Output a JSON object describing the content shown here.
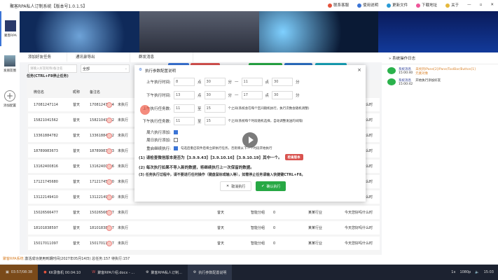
{
  "title": "聚客RPA私人订制系统【版本号1.0.1.5】",
  "titlebar_links": [
    "联系客服",
    "使用说明",
    "更新文件",
    "下载地址",
    "关于"
  ],
  "sidebar": {
    "items": [
      "聚客RPA",
      "发朋友圈",
      "添加配置"
    ]
  },
  "tabs": [
    "添加好友任务",
    "通讯录导出",
    "群发消息"
  ],
  "search": {
    "placeholder": "请输入好友昵称/备注名"
  },
  "select": {
    "value": "全部"
  },
  "task_label": "任务(CTRL+F8停止任务)",
  "table": {
    "headers": [
      "微信名",
      "昵称",
      "备注名"
    ],
    "rows": [
      [
        "17081247114",
        "昔天",
        "17081247114",
        "未执行",
        "昔天",
        "智能分组",
        "0",
        "某某行业",
        "今天您好吗什么时"
      ],
      [
        "15821041562",
        "昔天",
        "15821041562",
        "未执行",
        "昔天",
        "智能分组",
        "0",
        "某某行业",
        "今天您好吗什么时"
      ],
      [
        "13361884782",
        "昔天",
        "13361884782",
        "未执行",
        "昔天",
        "智能分组",
        "0",
        "某某行业",
        "今天您好吗什么时"
      ],
      [
        "18789983673",
        "昔天",
        "18789983673",
        "未执行",
        "昔天",
        "智能分组",
        "0",
        "某某行业",
        "今天您好吗什么时"
      ],
      [
        "13162400816",
        "昔天",
        "13162400816",
        "未执行",
        "昔天",
        "智能分组",
        "0",
        "某某行业",
        "今天您好吗什么时"
      ],
      [
        "17121745680",
        "昔天",
        "17121745680",
        "未执行",
        "昔天",
        "智能分组",
        "0",
        "某某行业",
        "今天您好吗什么时"
      ],
      [
        "13122149410",
        "昔天",
        "13122149410",
        "未执行",
        "昔天",
        "智能分组",
        "0",
        "某某行业",
        "今天您好吗什么时"
      ],
      [
        "15026566477",
        "昔天",
        "15026566477",
        "未执行",
        "昔天",
        "智能分组",
        "0",
        "某某行业",
        "今天您好吗什么时"
      ],
      [
        "18101838597",
        "昔天",
        "18101838597",
        "未执行",
        "昔天",
        "智能分组",
        "0",
        "某某行业",
        "今天您好吗什么时"
      ],
      [
        "15017011097",
        "昔天",
        "15017011097",
        "未执行",
        "昔天",
        "智能分组",
        "0",
        "某某行业",
        "今天您好吗什么时"
      ]
    ]
  },
  "right_panel": {
    "title": "系统操作日志",
    "logs": [
      {
        "name": "系统消息",
        "time": "15:00:40",
        "text": "未找到/Pane[2]/Pane/ToolBar/Button[1]元素对象"
      },
      {
        "name": "系统消息",
        "time": "15:00:42",
        "text": "开始执行添加好友"
      }
    ]
  },
  "modal": {
    "title": "执行参数配置说明",
    "close": "×",
    "am_label": "上午执行时间:",
    "am": [
      "8",
      "30",
      "11",
      "30"
    ],
    "pm_label": "下午执行时间:",
    "pm": [
      "13",
      "30",
      "17",
      "30"
    ],
    "u_hour": "点",
    "u_min": "分",
    "dash": "—",
    "am_count_label": "上午执行任务数:",
    "am_count": [
      "11",
      "15"
    ],
    "pm_count_label": "下午执行任务数:",
    "pm_count": [
      "11",
      "15"
    ],
    "to": "至",
    "am_hint": "个之间(系统会在每个区间随机执行，执行次数会随机调整)",
    "pm_hint": "个之间(系统每个时段随机选择，自动调整发送的间隔)",
    "weekend_label": "周六执行添加:",
    "sunday_label": "周日执行添加:",
    "repeat_label": "重启继续执行:",
    "repeat_hint": "勾选后重启软件后将立即执行任务，否则将从下一个时段开始执行",
    "note1": "(1) 请检查微信版本是否为【3.9.9.43】【3.9.10.16】【3.9.10.19】其中一个。",
    "note1_btn": "检查版本",
    "note2": "(2) 每次执行如果不导入新的数据，将继续执行上一次保留的数据。",
    "note3": "(3) 任务执行过程中，请不要进行任何操作（键盘鼠标或输入等），如需停止任务请输入快捷键CTRL+F8。",
    "cancel": "取消执行",
    "confirm": "确认执行"
  },
  "status": {
    "brand": "聚客RPA系统",
    "text": "激活成功使用到期时间(2027年05月14日)  总任务:157 待执行:157"
  },
  "taskbar": {
    "items": [
      "03:57/08:38",
      "KK录像机 00:04:10",
      "聚客RPA介绍.docx - ...",
      "聚客RPA私人订制...",
      "执行参数配置说明"
    ],
    "time": "15:03",
    "resolution": "1080p",
    "speed": "1x"
  },
  "colors": {
    "accent_red": "#d9534f",
    "green": "#27a844",
    "blue": "#3b74d6"
  }
}
